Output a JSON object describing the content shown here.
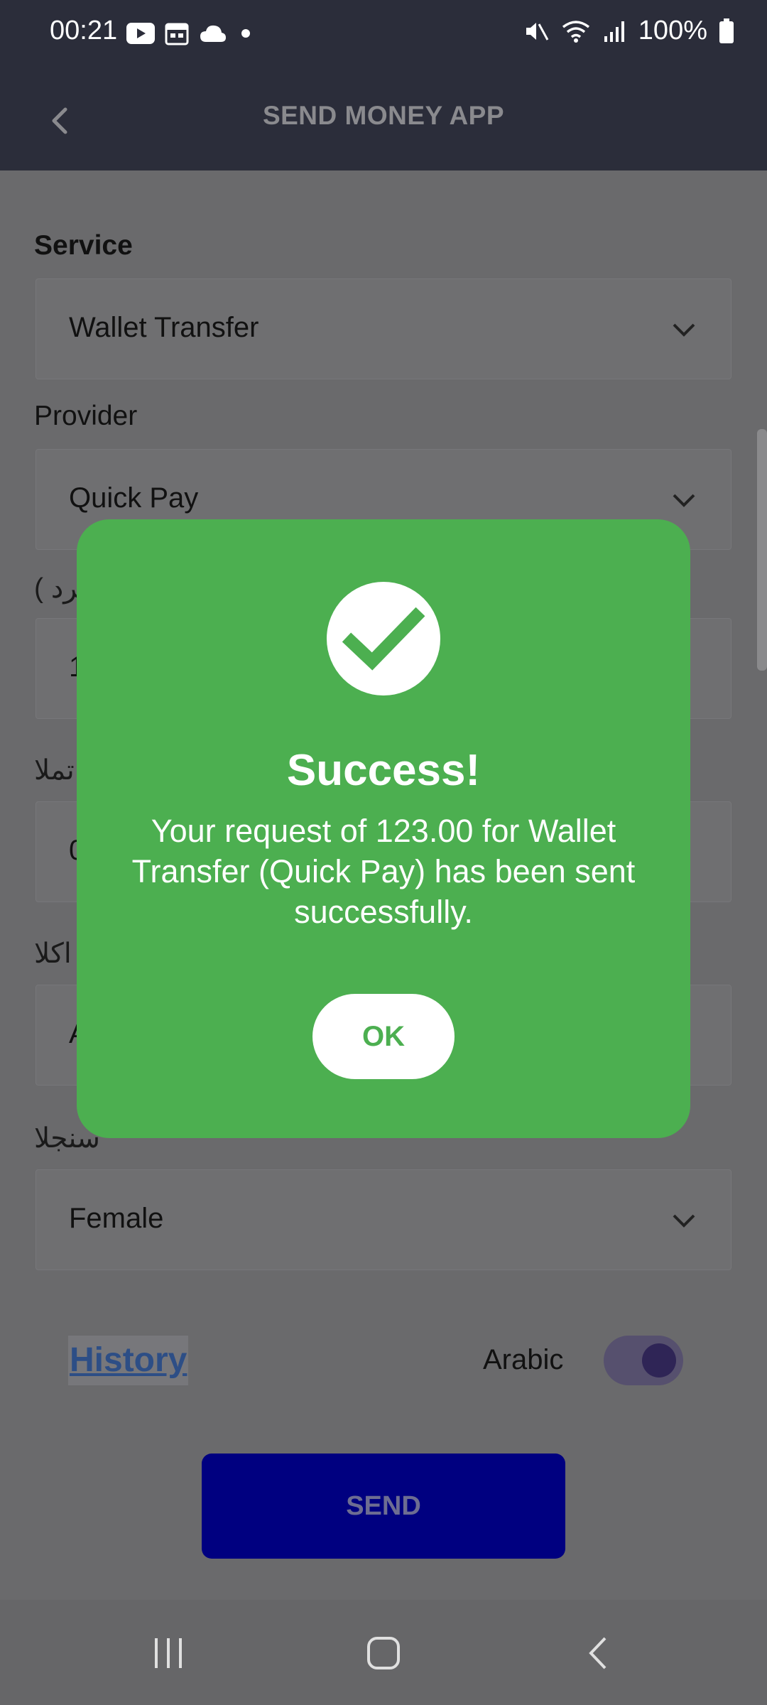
{
  "status_bar": {
    "time": "00:21",
    "battery": "100%"
  },
  "app_bar": {
    "title": "SEND MONEY APP"
  },
  "form": {
    "service_label": "Service",
    "service_value": "Wallet Transfer",
    "provider_label": "Provider",
    "provider_value": "Quick Pay",
    "field3_label_partial": "( برد",
    "field3_value_partial": "1",
    "field4_label_partial": "تملا",
    "field4_value_partial": "0",
    "field5_label_partial": "اكلا",
    "field5_value_partial": "A",
    "gender_label_partial": "سنجلا",
    "gender_value": "Female",
    "history_link": "History",
    "arabic_label": "Arabic",
    "arabic_toggle_on": true,
    "send_button": "SEND"
  },
  "dialog": {
    "title": "Success!",
    "message": "Your request of 123.00 for Wallet Transfer (Quick Pay) has been sent successfully.",
    "ok_button": "OK",
    "accent_color": "#4caf50"
  },
  "colors": {
    "status_bar": "#2b2d3a",
    "send_button": "#000080",
    "history_link": "#2d4e86"
  },
  "icons": {
    "status_left": [
      "youtube-icon",
      "calendar-icon",
      "cloud-icon",
      "dot-icon"
    ],
    "status_right": [
      "mute-icon",
      "wifi-icon",
      "signal-icon",
      "battery-icon"
    ],
    "nav": [
      "recent-apps-icon",
      "home-icon",
      "back-icon"
    ]
  }
}
